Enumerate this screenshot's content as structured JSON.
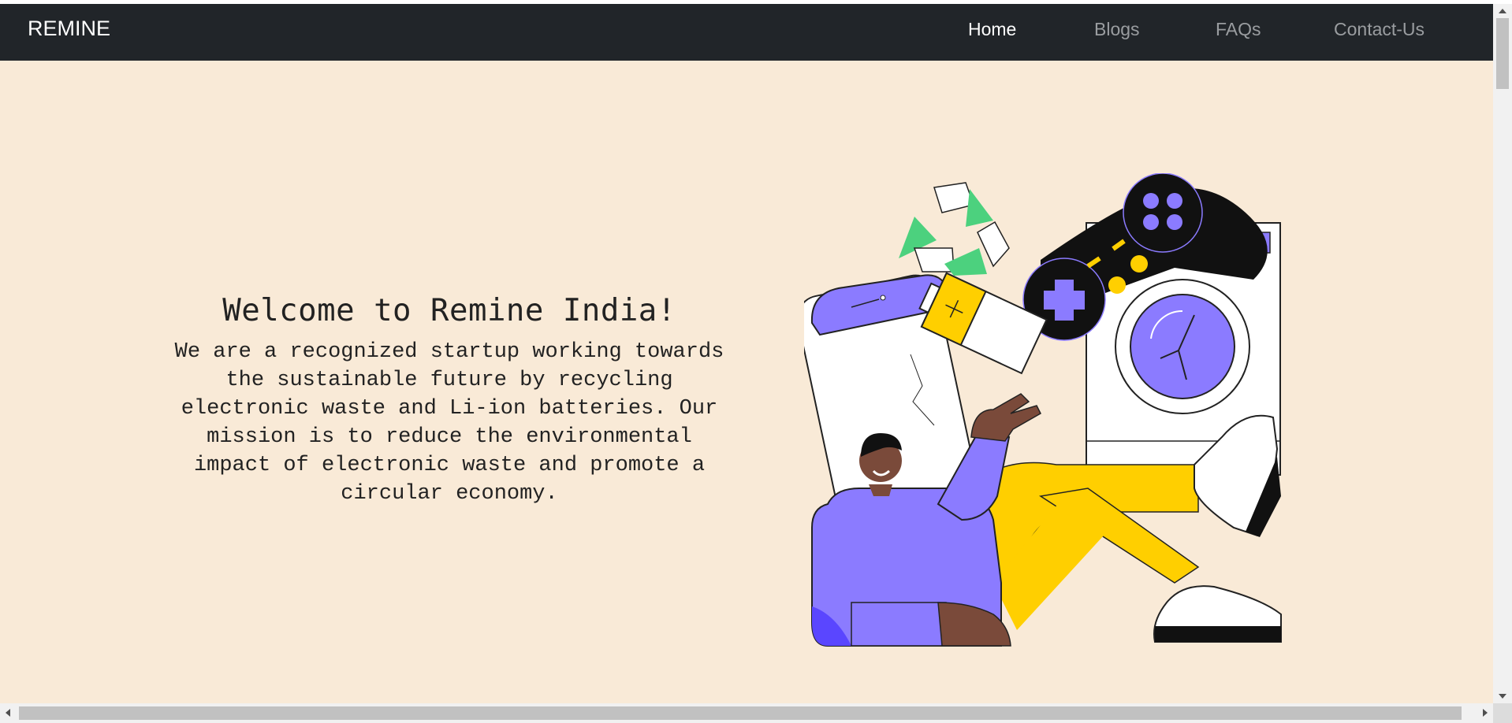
{
  "navbar": {
    "brand": "REMINE",
    "links": [
      {
        "label": "Home",
        "active": true
      },
      {
        "label": "Blogs",
        "active": false
      },
      {
        "label": "FAQs",
        "active": false
      },
      {
        "label": "Contact-Us",
        "active": false
      }
    ]
  },
  "hero": {
    "title": "Welcome to Remine India!",
    "description": "We are a recognized startup working towards the sustainable future by recycling electronic waste and Li-ion batteries. Our mission is to reduce the environmental impact of electronic waste and promote a circular economy."
  },
  "colors": {
    "background": "#f9ead7",
    "navbar": "#212529",
    "purple": "#8b7bff",
    "yellow": "#ffcf00",
    "green": "#4cd17e",
    "skin": "#7a4a3a"
  },
  "icons": {
    "illustration": "person-with-ewaste-illustration"
  }
}
